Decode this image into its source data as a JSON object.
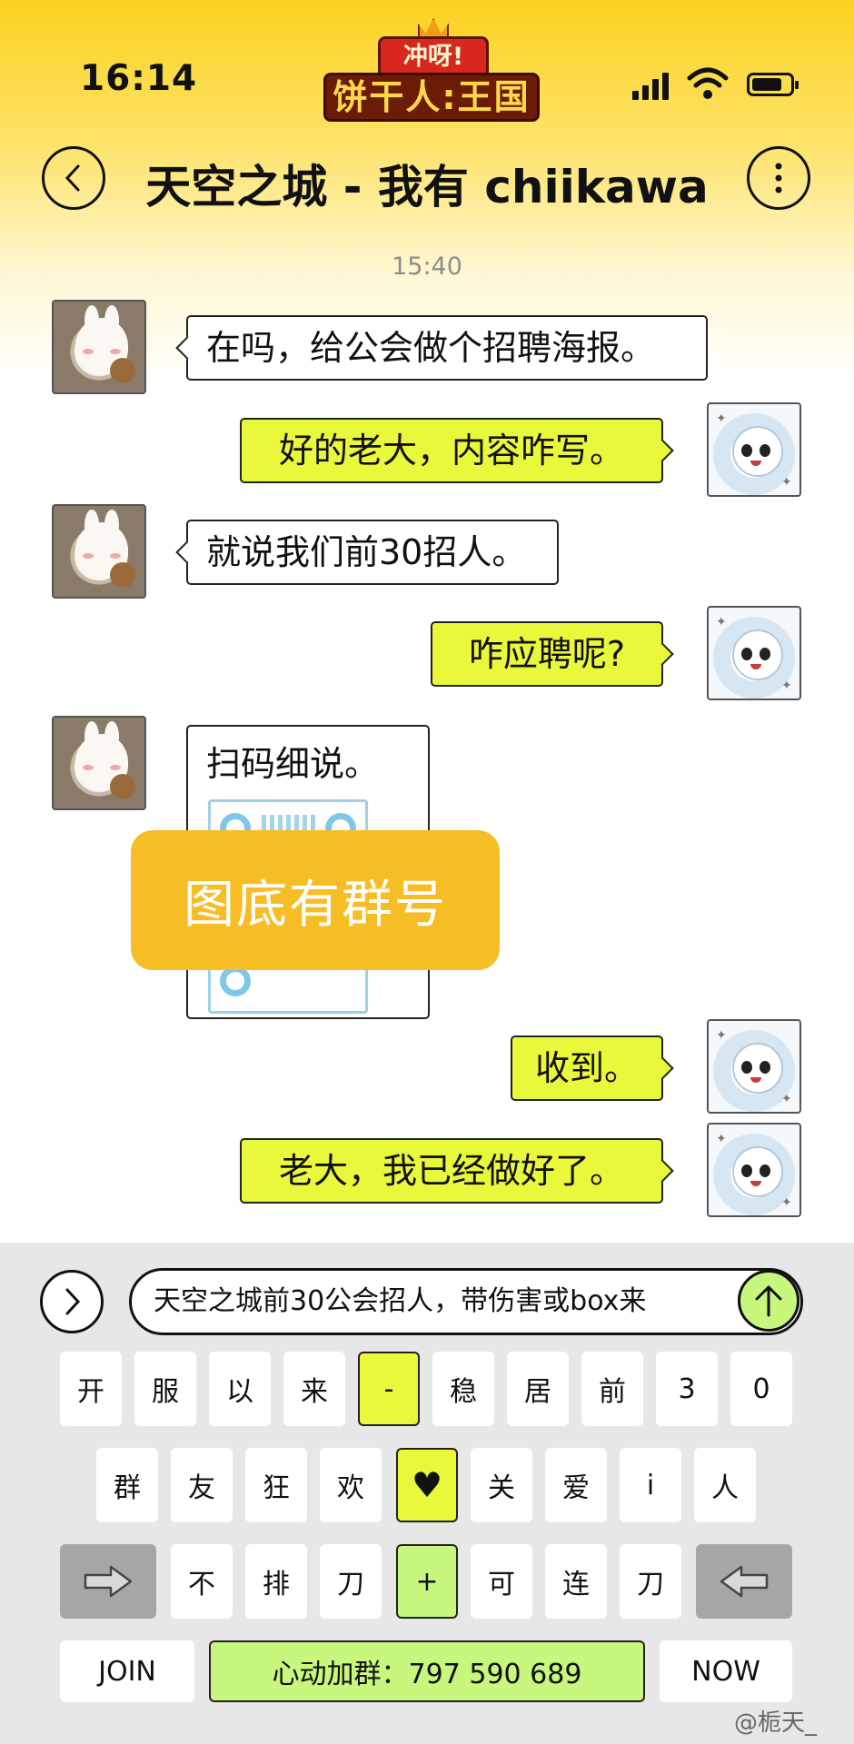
{
  "status": {
    "time": "16:14"
  },
  "logo": {
    "top_text": "冲呀!",
    "main_text": "饼干人:王国"
  },
  "header": {
    "title": "天空之城 - 我有 chiikawa",
    "back_icon": "chevron-left-icon",
    "more_icon": "more-vertical-icon"
  },
  "chat": {
    "timestamp": "15:40",
    "messages": [
      {
        "side": "left",
        "text": "在吗，给公会做个招聘海报。"
      },
      {
        "side": "right",
        "text": "好的老大，内容咋写。"
      },
      {
        "side": "left",
        "text": "就说我们前30招人。"
      },
      {
        "side": "right",
        "text": "咋应聘呢?"
      },
      {
        "side": "left",
        "text": "扫码细说。"
      },
      {
        "side": "right",
        "text": "收到。"
      },
      {
        "side": "right",
        "text": "老大，我已经做好了。"
      }
    ],
    "overlay": "图底有群号"
  },
  "composer": {
    "input_value": "天空之城前30公会招人，带伤害或box来"
  },
  "keyboard": {
    "row1": [
      "开",
      "服",
      "以",
      "来",
      "-",
      "稳",
      "居",
      "前",
      "3",
      "0"
    ],
    "row2": [
      "群",
      "友",
      "狂",
      "欢",
      "♥",
      "关",
      "爱",
      "i",
      "人"
    ],
    "row3": [
      "不",
      "排",
      "刀",
      "+",
      "可",
      "连",
      "刀"
    ],
    "bottom": {
      "left": "JOIN",
      "center": "心动加群：797 590 689",
      "right": "NOW"
    }
  },
  "watermark": "@栀天_",
  "colors": {
    "accent_yellow": "#e9f83b",
    "accent_green": "#c8f77e",
    "overlay": "#f6bd24",
    "header_gold": "#fcd21f"
  }
}
